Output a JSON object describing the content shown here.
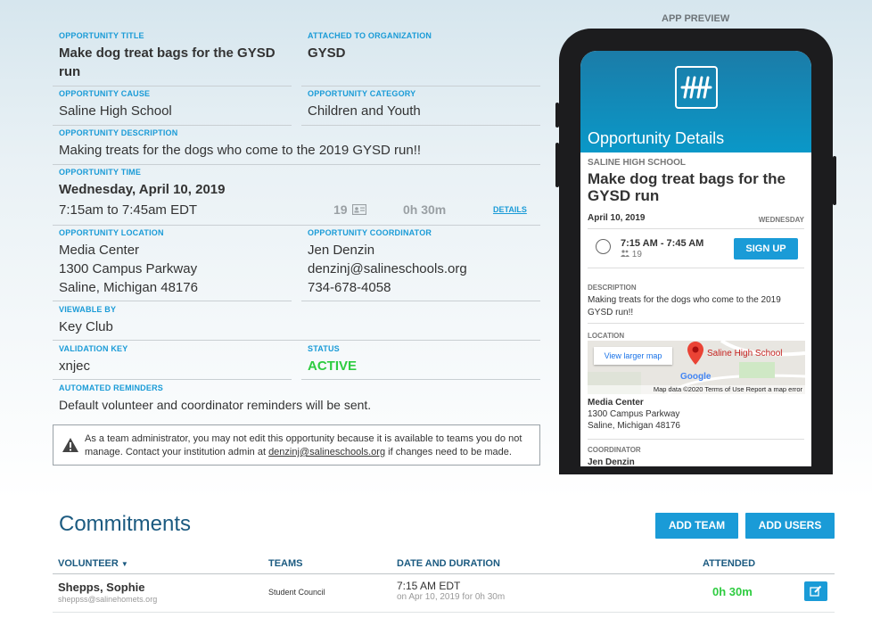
{
  "form": {
    "opportunity_title": {
      "label": "OPPORTUNITY TITLE",
      "value": "Make dog treat bags for the GYSD run"
    },
    "attached_org": {
      "label": "ATTACHED TO ORGANIZATION",
      "value": "GYSD"
    },
    "cause": {
      "label": "OPPORTUNITY CAUSE",
      "value": "Saline High School"
    },
    "category": {
      "label": "OPPORTUNITY CATEGORY",
      "value": "Children and Youth"
    },
    "description": {
      "label": "OPPORTUNITY DESCRIPTION",
      "value": "Making treats for the dogs who come to the 2019 GYSD run!!"
    },
    "time": {
      "label": "OPPORTUNITY TIME",
      "date": "Wednesday, April 10, 2019",
      "range": "7:15am to 7:45am EDT",
      "count": "19",
      "duration": "0h 30m",
      "details_link": "DETAILS"
    },
    "location": {
      "label": "OPPORTUNITY LOCATION",
      "line1": "Media Center",
      "line2": "1300 Campus Parkway",
      "line3": "Saline, Michigan 48176"
    },
    "coordinator": {
      "label": "OPPORTUNITY COORDINATOR",
      "name": "Jen Denzin",
      "email": "denzinj@salineschools.org",
      "phone": "734-678-4058"
    },
    "viewable_by": {
      "label": "VIEWABLE BY",
      "value": "Key Club"
    },
    "validation_key": {
      "label": "VALIDATION KEY",
      "value": "xnjec"
    },
    "status": {
      "label": "STATUS",
      "value": "ACTIVE"
    },
    "reminders": {
      "label": "AUTOMATED REMINDERS",
      "value": "Default volunteer and coordinator reminders will be sent."
    },
    "notice": {
      "text_before": "As a team administrator, you may not edit this opportunity because it is available to teams you do not manage. Contact your institution admin at ",
      "email": "denzinj@salineschools.org",
      "text_after": " if changes need to be made."
    }
  },
  "preview": {
    "label": "APP PREVIEW",
    "screen_title": "Opportunity Details",
    "org": "SALINE HIGH SCHOOL",
    "title": "Make dog treat bags for the GYSD run",
    "date": "April 10, 2019",
    "weekday": "WEDNESDAY",
    "time": "7:15 AM - 7:45 AM",
    "count": "19",
    "signup": "SIGN UP",
    "description_label": "DESCRIPTION",
    "description": "Making treats for the dogs who come to the 2019 GYSD run!!",
    "location_label": "LOCATION",
    "map_view_larger": "View larger map",
    "map_place": "Saline High School",
    "map_google": "Google",
    "map_footer": "Map data ©2020   Terms of Use   Report a map error",
    "loc_name": "Media Center",
    "loc_line1": "1300 Campus Parkway",
    "loc_line2": "Saline, Michigan 48176",
    "coordinator_label": "COORDINATOR",
    "coordinator_name": "Jen Denzin"
  },
  "commitments": {
    "title": "Commitments",
    "add_team": "ADD TEAM",
    "add_users": "ADD USERS",
    "columns": {
      "volunteer": "VOLUNTEER",
      "teams": "TEAMS",
      "date_duration": "DATE AND DURATION",
      "attended": "ATTENDED"
    },
    "rows": [
      {
        "name": "Shepps, Sophie",
        "email": "sheppss@salinehomets.org",
        "team": "Student Council",
        "time": "7:15 AM EDT",
        "date_detail": "on Apr 10, 2019 for 0h 30m",
        "attended": "0h 30m"
      }
    ]
  },
  "colors": {
    "accent": "#1a9bd7",
    "active": "#2ecc40",
    "heading": "#1b5a80"
  }
}
